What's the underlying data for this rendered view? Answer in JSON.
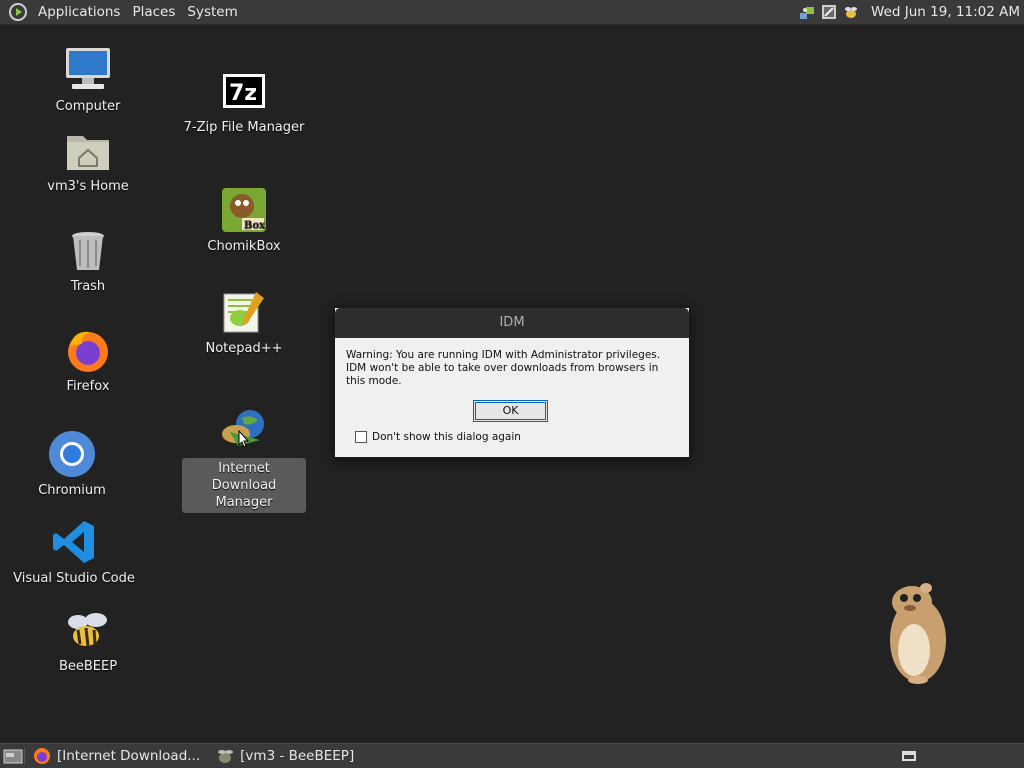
{
  "top_panel": {
    "menus": [
      "Applications",
      "Places",
      "System"
    ],
    "clock": "Wed Jun 19, 11:02 AM"
  },
  "desktop": {
    "icons": [
      {
        "label": "Computer",
        "icon": "computer-icon"
      },
      {
        "label": "vm3's Home",
        "icon": "home-folder-icon"
      },
      {
        "label": "Trash",
        "icon": "trash-icon"
      },
      {
        "label": "Firefox",
        "icon": "firefox-icon"
      },
      {
        "label": "Chromium",
        "icon": "chromium-icon"
      },
      {
        "label": "Visual Studio Code",
        "icon": "vscode-icon"
      },
      {
        "label": "BeeBEEP",
        "icon": "beebeep-icon"
      },
      {
        "label": "7-Zip File Manager",
        "icon": "7zip-icon"
      },
      {
        "label": "ChomikBox",
        "icon": "chomikbox-icon"
      },
      {
        "label": "Notepad++",
        "icon": "notepadpp-icon"
      },
      {
        "label": "Internet Download Manager",
        "icon": "idm-icon"
      }
    ]
  },
  "dialog": {
    "title": "IDM",
    "message": "Warning: You are running IDM with Administrator privileges. IDM won't be able to take over downloads from browsers in this mode.",
    "ok_label": "OK",
    "checkbox_label": "Don't show this dialog again",
    "checkbox_checked": false
  },
  "taskbar": {
    "tasks": [
      {
        "label": "[Internet Download...",
        "icon": "firefox-icon"
      },
      {
        "label": "[vm3 - BeeBEEP]",
        "icon": "beebeep-icon"
      }
    ]
  }
}
